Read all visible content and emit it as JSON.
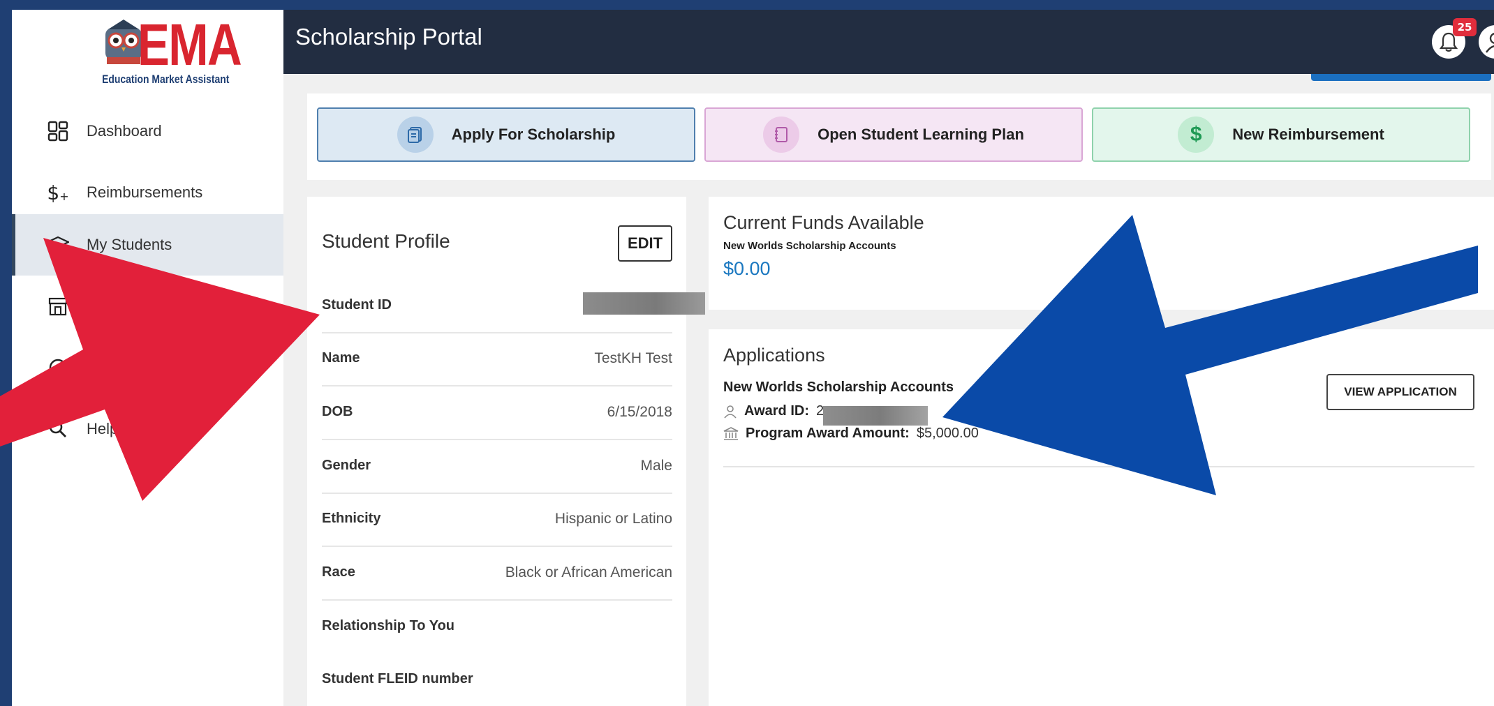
{
  "sidebar": {
    "logo": {
      "brand": "EMA",
      "tagline": "Education Market Assistant"
    },
    "items": [
      {
        "label": "Dashboard",
        "icon": "grid-icon"
      },
      {
        "label": "Reimbursements",
        "icon": "dollar-plus-icon"
      },
      {
        "label": "My Students",
        "icon": "graduation-cap-icon"
      },
      {
        "label": "",
        "icon": "storefront-icon"
      },
      {
        "label": "",
        "icon": "circle-icon"
      },
      {
        "label": "Help",
        "icon": "search-icon"
      }
    ]
  },
  "header": {
    "title": "Scholarship Portal",
    "notification_count": "25"
  },
  "actions": [
    {
      "label": "Apply For Scholarship",
      "icon": "document-icon"
    },
    {
      "label": "Open Student Learning Plan",
      "icon": "notebook-icon"
    },
    {
      "label": "New Reimbursement",
      "icon": "dollar-icon"
    }
  ],
  "profile": {
    "title": "Student Profile",
    "edit_label": "EDIT",
    "rows": [
      {
        "label": "Student ID",
        "value": ""
      },
      {
        "label": "Name",
        "value": "TestKH Test"
      },
      {
        "label": "DOB",
        "value": "6/15/2018"
      },
      {
        "label": "Gender",
        "value": "Male"
      },
      {
        "label": "Ethnicity",
        "value": "Hispanic or Latino"
      },
      {
        "label": "Race",
        "value": "Black or African American"
      },
      {
        "label": "Relationship To You",
        "value": ""
      },
      {
        "label": "Student FLEID number",
        "value": ""
      }
    ]
  },
  "funds": {
    "title": "Current Funds Available",
    "account": "New Worlds Scholarship Accounts",
    "amount": "$0.00"
  },
  "applications": {
    "title": "Applications",
    "name": "New Worlds Scholarship Accounts",
    "award_id_label": "Award ID:",
    "award_id_value": "2",
    "program_award_label": "Program Award Amount:",
    "program_award_value": "$5,000.00",
    "view_label": "VIEW APPLICATION"
  },
  "colors": {
    "page_bg": "#1f3f73",
    "header_bg": "#222d41",
    "accent_blue": "#1b78c0",
    "arrow_red": "#e2203a",
    "arrow_blue": "#0a4aa8"
  }
}
